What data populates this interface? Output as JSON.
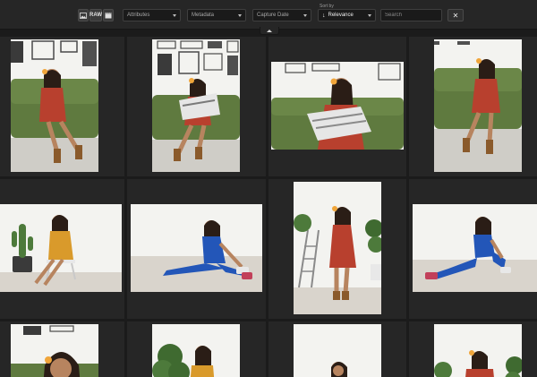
{
  "filter_bar": {
    "type_buttons": [
      {
        "label": "",
        "icon": "image-icon"
      },
      {
        "label": "RAW",
        "icon": ""
      },
      {
        "label": "",
        "icon": "video-icon"
      }
    ],
    "attributes": {
      "label": "Attributes"
    },
    "metadata": {
      "label": "Metadata"
    },
    "capture_date": {
      "label": "Capture Date"
    },
    "sort": {
      "label": "Sort by",
      "value": "Relevance",
      "icon": "sort-arrow-down-icon"
    },
    "search": {
      "placeholder": "Search",
      "value": ""
    },
    "clear": {
      "label": "✕",
      "icon": "close-icon"
    },
    "collapse": {
      "icon": "chevron-up-icon"
    }
  },
  "colors": {
    "background": "#1b1b1b",
    "bar": "#262626",
    "cell": "#262626",
    "wall": "#f3f3f0",
    "sofa": "#5f7a3f",
    "dress_red": "#b8402e",
    "outfit_yellow": "#d99a2b",
    "outfit_blue": "#2356b8"
  },
  "photos": [
    {
      "subject": "sofa",
      "outfit": "red",
      "orientation": "portrait"
    },
    {
      "subject": "sofa-magazine",
      "outfit": "red",
      "orientation": "portrait"
    },
    {
      "subject": "sofa-magazine",
      "outfit": "red",
      "orientation": "landscape"
    },
    {
      "subject": "sofa",
      "outfit": "red",
      "orientation": "portrait"
    },
    {
      "subject": "chair-cactus",
      "outfit": "yellow",
      "orientation": "landscape"
    },
    {
      "subject": "stretch-floor",
      "outfit": "blue",
      "orientation": "landscape"
    },
    {
      "subject": "standing-ladder",
      "outfit": "red",
      "orientation": "portrait"
    },
    {
      "subject": "sitting-floor",
      "outfit": "blue",
      "orientation": "landscape"
    },
    {
      "subject": "closeup",
      "outfit": "red",
      "orientation": "landscape"
    },
    {
      "subject": "plant",
      "outfit": "yellow",
      "orientation": "landscape"
    },
    {
      "subject": "closeup",
      "outfit": "red",
      "orientation": "landscape"
    },
    {
      "subject": "plant",
      "outfit": "red",
      "orientation": "landscape"
    }
  ]
}
